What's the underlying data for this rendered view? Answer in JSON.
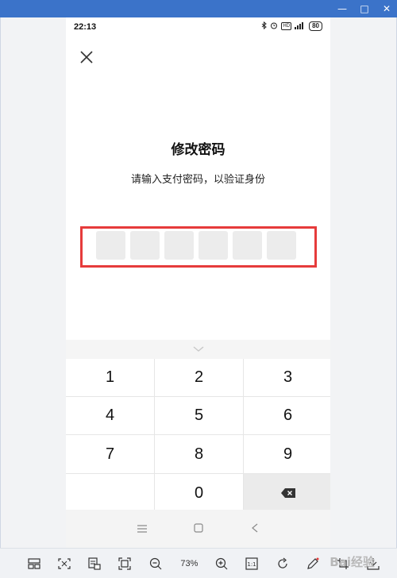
{
  "window": {
    "min": "—",
    "max": "□",
    "close": "✕"
  },
  "status_bar": {
    "time": "22:13",
    "battery": "80",
    "hd": "HD"
  },
  "page": {
    "title": "修改密码",
    "subtitle": "请输入支付密码，以验证身份",
    "pin_length": 6
  },
  "keypad": {
    "keys": [
      "1",
      "2",
      "3",
      "4",
      "5",
      "6",
      "7",
      "8",
      "9",
      "",
      "0",
      "⌫"
    ]
  },
  "toolbar": {
    "zoom": "73%"
  },
  "watermark": "Bai经验",
  "colors": {
    "highlight": "#e63b3b",
    "titlebar": "#3b73c9"
  }
}
